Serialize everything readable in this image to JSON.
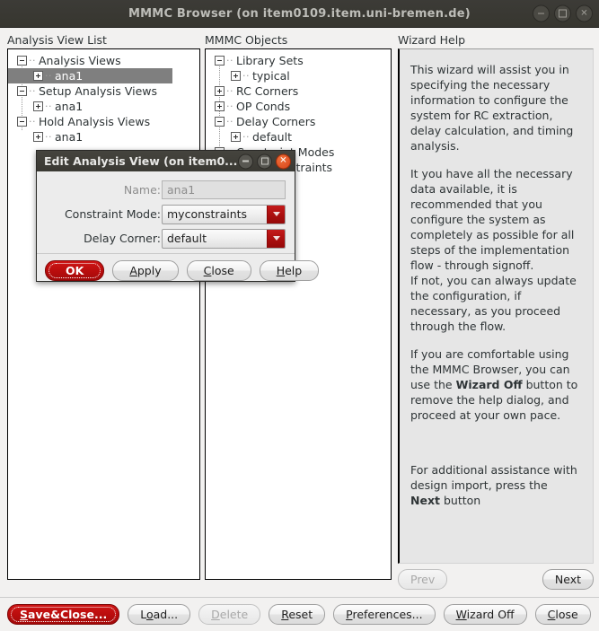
{
  "window": {
    "title": "MMMC Browser (on item0109.item.uni-bremen.de)",
    "controls": {
      "minimize": "minimize-icon",
      "maximize": "maximize-icon",
      "close": "close-icon"
    }
  },
  "columns": {
    "analysis_view_list": "Analysis View List",
    "mmmc_objects": "MMMC Objects",
    "wizard_help": "Wizard Help"
  },
  "analysis_tree": [
    {
      "label": "Analysis Views",
      "state": "-",
      "level": 1,
      "selected": false
    },
    {
      "label": "ana1",
      "state": "+",
      "level": 2,
      "selected": true
    },
    {
      "label": "Setup Analysis Views",
      "state": "-",
      "level": 1,
      "selected": false
    },
    {
      "label": "ana1",
      "state": "+",
      "level": 2,
      "selected": false
    },
    {
      "label": "Hold Analysis Views",
      "state": "-",
      "level": 1,
      "selected": false
    },
    {
      "label": "ana1",
      "state": "+",
      "level": 2,
      "selected": false
    }
  ],
  "objects_tree": [
    {
      "label": "Library Sets",
      "state": "-",
      "level": 1
    },
    {
      "label": "typical",
      "state": "+",
      "level": 2
    },
    {
      "label": "RC Corners",
      "state": "+",
      "level": 1
    },
    {
      "label": "OP Conds",
      "state": "+",
      "level": 1
    },
    {
      "label": "Delay Corners",
      "state": "-",
      "level": 1
    },
    {
      "label": "default",
      "state": "+",
      "level": 2
    },
    {
      "label": "Constraint Modes",
      "state": "-",
      "level": 1
    },
    {
      "label": "myconstraints",
      "state": "+",
      "level": 2
    }
  ],
  "help": {
    "para1": "This wizard will assist you in specifying the necessary information to configure the system for RC extraction, delay calculation, and timing analysis.",
    "para2_a": "It you have all the necessary data available, it is recommended that you configure the system as completely as possible for all steps of the implementation flow - through signoff.",
    "para2_b": "If not, you can always update the configuration, if necessary, as you proceed through the flow.",
    "para3_pre": "If you are comfortable using the MMMC Browser, you can use the ",
    "para3_bold": "Wizard Off",
    "para3_post": " button to remove the help dialog, and proceed at your own pace.",
    "para4_pre": "For additional assistance with design import, press the ",
    "para4_bold": "Next",
    "para4_post": " button"
  },
  "wizard_nav": {
    "prev": "Prev",
    "prev_enabled": false,
    "next": "Next",
    "next_enabled": true
  },
  "bottom_buttons": [
    {
      "label": "Save&Close...",
      "mnemonic": "S",
      "style": "danger",
      "enabled": true
    },
    {
      "label": "Load...",
      "mnemonic": "o",
      "style": "normal",
      "enabled": true
    },
    {
      "label": "Delete",
      "mnemonic": "D",
      "style": "normal",
      "enabled": false
    },
    {
      "label": "Reset",
      "mnemonic": "R",
      "style": "normal",
      "enabled": true
    },
    {
      "label": "Preferences...",
      "mnemonic": "P",
      "style": "normal",
      "enabled": true
    },
    {
      "label": "Wizard Off",
      "mnemonic": "W",
      "style": "normal",
      "enabled": true
    },
    {
      "label": "Close",
      "mnemonic": "C",
      "style": "normal",
      "enabled": true
    },
    {
      "label": "Help",
      "mnemonic": "H",
      "style": "normal",
      "enabled": true
    }
  ],
  "dialog": {
    "title": "Edit Analysis View (on item0...",
    "fields": {
      "name_label": "Name:",
      "name_value": "ana1",
      "constraint_mode_label": "Constraint Mode:",
      "constraint_mode_value": "myconstraints",
      "delay_corner_label": "Delay Corner:",
      "delay_corner_value": "default"
    },
    "buttons": {
      "ok": "OK",
      "apply": "Apply",
      "close": "Close",
      "help": "Help"
    }
  },
  "colors": {
    "danger": "#ba0d0d",
    "titlebar": "#3a3933",
    "selection": "#7f7f7f",
    "help_bg": "#e6e6e6"
  }
}
